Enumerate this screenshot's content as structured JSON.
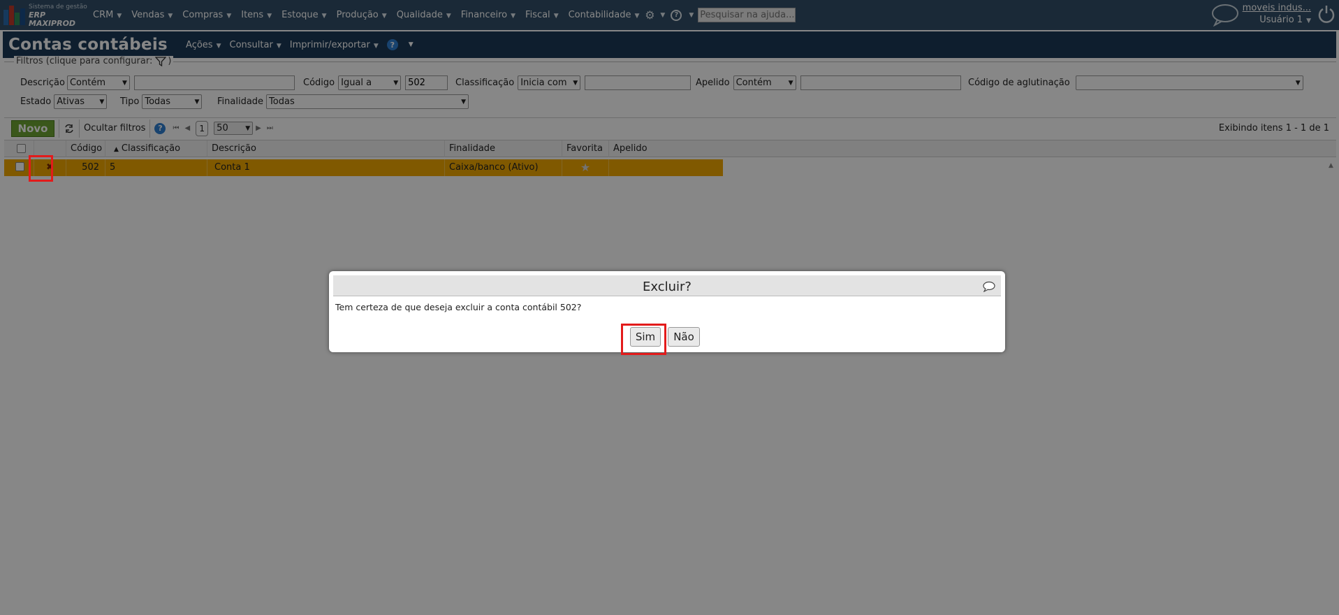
{
  "topbar": {
    "logo_line1": "Sistema de gestão",
    "logo_line2": "ERP MAXIPROD",
    "menu": [
      "CRM",
      "Vendas",
      "Compras",
      "Itens",
      "Estoque",
      "Produção",
      "Qualidade",
      "Financeiro",
      "Fiscal",
      "Contabilidade"
    ],
    "search_placeholder": "Pesquisar na ajuda...",
    "company": "moveis indus...",
    "user": "Usuário 1"
  },
  "titlebar": {
    "title": "Contas contábeis",
    "menus": [
      "Ações",
      "Consultar",
      "Imprimir/exportar"
    ]
  },
  "filters": {
    "legend": "Filtros (clique para configurar:",
    "legend_close": ")",
    "descricao_label": "Descrição",
    "descricao_op": "Contém",
    "descricao_value": "",
    "codigo_label": "Código",
    "codigo_op": "Igual a",
    "codigo_value": "502",
    "classificacao_label": "Classificação",
    "classificacao_op": "Inicia com",
    "classificacao_value": "",
    "apelido_label": "Apelido",
    "apelido_op": "Contém",
    "apelido_value": "",
    "aglutinacao_label": "Código de aglutinação",
    "aglutinacao_value": "",
    "estado_label": "Estado",
    "estado_value": "Ativas",
    "tipo_label": "Tipo",
    "tipo_value": "Todas",
    "finalidade_label": "Finalidade",
    "finalidade_value": "Todas"
  },
  "toolbar": {
    "novo": "Novo",
    "hide_filters": "Ocultar filtros",
    "page": "1",
    "page_size": "50",
    "shown": "Exibindo itens 1 - 1 de 1"
  },
  "grid": {
    "headers": {
      "codigo": "Código",
      "classificacao": "Classificação",
      "descricao": "Descrição",
      "finalidade": "Finalidade",
      "favorita": "Favorita",
      "apelido": "Apelido"
    },
    "rows": [
      {
        "codigo": "502",
        "classificacao": "5",
        "descricao": "Conta 1",
        "finalidade": "Caixa/banco (Ativo)",
        "apelido": ""
      }
    ]
  },
  "modal": {
    "title": "Excluir?",
    "message": "Tem certeza de que deseja excluir a conta contábil 502?",
    "yes": "Sim",
    "no": "Não"
  },
  "colors": {
    "topbar": "#314f68",
    "titlebar": "#1c3a57",
    "selected_row": "#f2a800",
    "novo_button": "#6fa533",
    "highlight": "#e31b1b"
  }
}
